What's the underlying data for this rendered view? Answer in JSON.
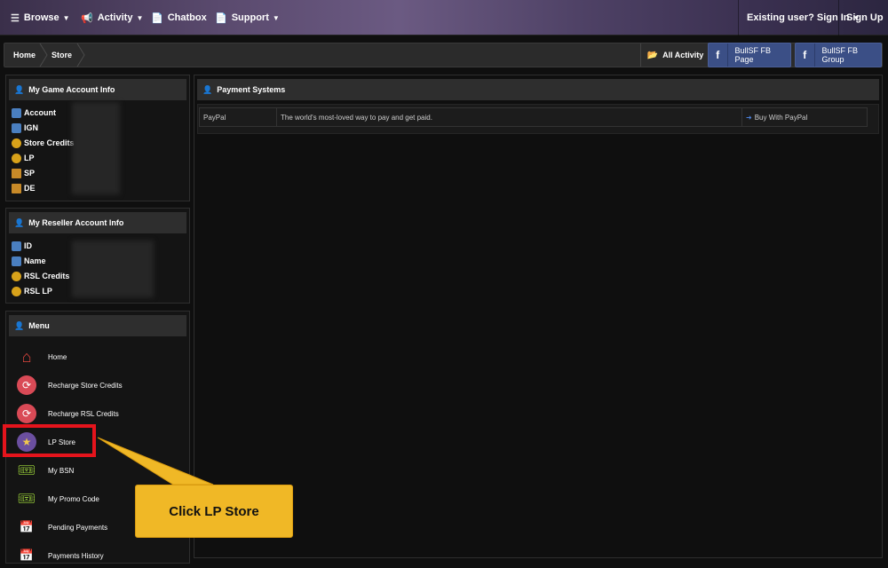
{
  "nav": {
    "browse": "Browse",
    "activity": "Activity",
    "chatbox": "Chatbox",
    "support": "Support",
    "signin": "Existing user? Sign In",
    "signup": "Sign Up"
  },
  "breadcrumb": {
    "home": "Home",
    "store": "Store",
    "all_activity": "All Activity",
    "fb_page": "BullSF FB Page",
    "fb_group": "BullSF FB Group"
  },
  "game_account": {
    "title": "My Game Account Info",
    "rows": [
      "Account",
      "IGN",
      "Store Credits",
      "LP",
      "SP",
      "DE"
    ]
  },
  "reseller_account": {
    "title": "My Reseller Account Info",
    "rows": [
      "ID",
      "Name",
      "RSL Credits",
      "RSL LP"
    ]
  },
  "menu": {
    "title": "Menu",
    "items": [
      "Home",
      "Recharge Store Credits",
      "Recharge RSL Credits",
      "LP Store",
      "My BSN",
      "My Promo Code",
      "Pending Payments",
      "Payments History"
    ]
  },
  "payment": {
    "title": "Payment Systems",
    "method": "PayPal",
    "description": "The world's most-loved way to pay and get paid.",
    "action": "Buy With PayPal"
  },
  "callout": {
    "text": "Click LP Store"
  },
  "colors": {
    "highlight": "#e5141c",
    "callout": "#f0b826",
    "facebook": "#3b4f86"
  }
}
